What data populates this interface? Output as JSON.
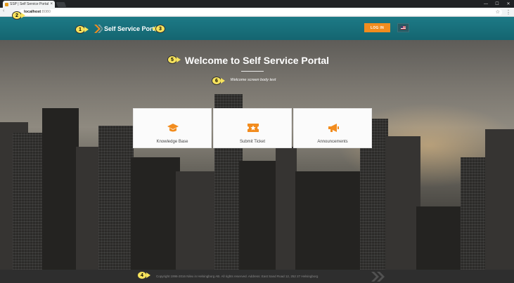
{
  "browser": {
    "tab_title": "SSP | Self Service Portal",
    "tab_close": "×",
    "url_host": "localhost",
    "url_port": ":8080",
    "window_controls": [
      "—",
      "☐",
      "✕"
    ],
    "bookmark_icon": "star-icon",
    "menu_icon": "kebab-menu-icon"
  },
  "header": {
    "brand_name": "Self Service Portal",
    "login_label": "LOG IN",
    "language_icon": "us-flag-icon",
    "accent_color": "#f28c1e",
    "bar_color": "#1d7a86"
  },
  "hero": {
    "title": "Welcome to Self Service Portal",
    "body": "Welcome screen body text"
  },
  "cards": [
    {
      "label": "Knowledge Base",
      "icon": "graduation-cap-icon"
    },
    {
      "label": "Submit Ticket",
      "icon": "ticket-star-icon"
    },
    {
      "label": "Announcements",
      "icon": "megaphone-icon"
    }
  ],
  "footer": {
    "copyright": "Copyright 1996-2016 Nilex in Helsingborg AB. All rights reserved. Address: East Sand Road 12, 252 27 Helsingborg"
  },
  "callouts": [
    "1",
    "2",
    "3",
    "4",
    "5",
    "6"
  ],
  "callout_color": "#f7e35c"
}
